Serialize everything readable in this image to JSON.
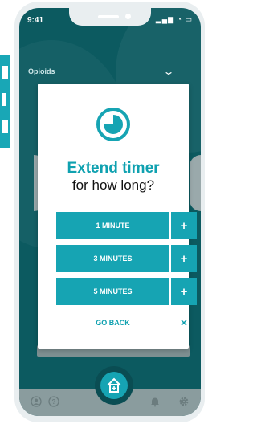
{
  "status": {
    "time": "9:41",
    "icons": "▂▄▆ ◔ ▭"
  },
  "header": {
    "title": "Opioids"
  },
  "modal": {
    "title": "Extend timer",
    "subtitle": "for how long?",
    "options": [
      {
        "label": "1 MINUTE",
        "action": "+"
      },
      {
        "label": "3 MINUTES",
        "action": "+"
      },
      {
        "label": "5 MINUTES",
        "action": "+"
      }
    ],
    "back_label": "GO BACK",
    "back_action": "✕"
  },
  "nav": {
    "icons": [
      "profile-icon",
      "help-icon",
      "home-icon",
      "bell-icon",
      "gear-icon"
    ]
  },
  "colors": {
    "accent": "#16a4b3",
    "screen_bg": "#0c5a60",
    "bottom_bar": "#8a9c9e"
  }
}
